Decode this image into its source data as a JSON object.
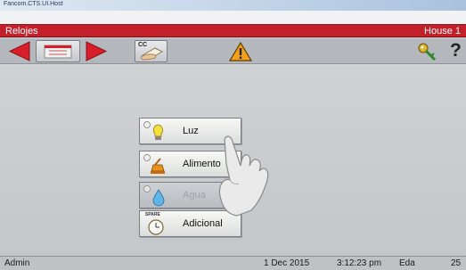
{
  "window": {
    "title": "Fancom.CTS.UI.Host"
  },
  "header": {
    "title": "Relojes",
    "house": "House 1"
  },
  "toolbar": {
    "cc_label": "CC",
    "help_label": "?",
    "icons": [
      "arrow-left-icon",
      "calendar-icon",
      "arrow-right-icon",
      "hand-card-icon",
      "warning-icon",
      "key-icon",
      "help-icon"
    ]
  },
  "menu": [
    {
      "label": "Luz",
      "icon": "bulb-icon",
      "enabled": true
    },
    {
      "label": "Alimento",
      "icon": "feed-icon",
      "enabled": true
    },
    {
      "label": "Agua",
      "icon": "water-drop-icon",
      "enabled": false
    },
    {
      "label": "Adicional",
      "icon": "clock-icon",
      "enabled": true,
      "badge": "SPARE"
    }
  ],
  "status": {
    "user": "Admin",
    "date": "1 Dec 2015",
    "time": "3:12:23 pm",
    "label": "Eda",
    "value": "25"
  },
  "colors": {
    "header_red": "#c4202c",
    "arrow_red": "#d81e2a",
    "warning_orange": "#f2a01c"
  }
}
